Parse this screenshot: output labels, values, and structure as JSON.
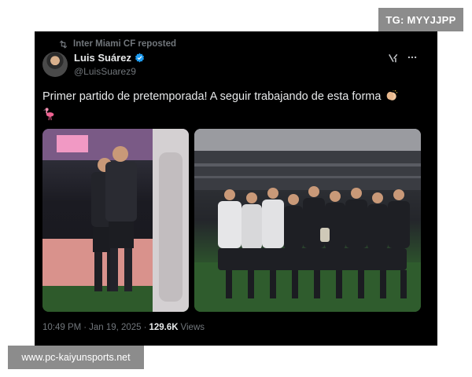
{
  "badges": {
    "tag": "TG: MYYJJPP",
    "url": "www.pc-kaiyunsports.net"
  },
  "tweet": {
    "repost_text": "Inter Miami CF reposted",
    "author_name": "Luis Suárez",
    "author_handle": "@LuisSuarez9",
    "text": "Primer partido de pretemporada! A seguir trabajando de esta forma",
    "time": "10:49 PM",
    "separator": "·",
    "date": "Jan 19, 2025",
    "separator2": "·",
    "view_count": "129.6K",
    "views_label": "Views"
  },
  "colors": {
    "card_bg": "#000000",
    "text_primary": "#e7e9ea",
    "text_secondary": "#71767b",
    "verified": "#1d9bf0",
    "badge_bg": "#8c8c8c"
  },
  "icons": [
    "repost-icon",
    "verified-icon",
    "grok-icon",
    "more-icon",
    "clapping-hands-icon",
    "flamingo-icon"
  ]
}
